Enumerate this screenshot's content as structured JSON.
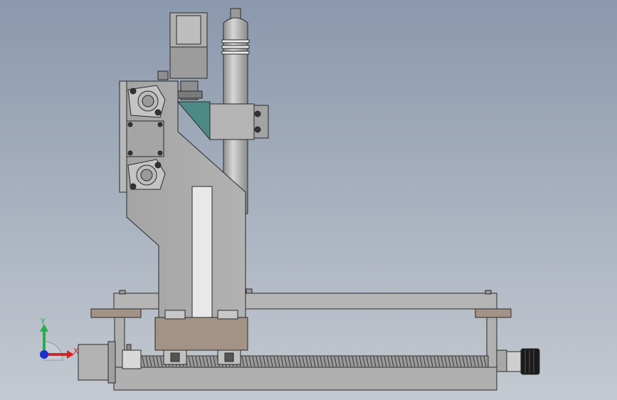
{
  "viewport": {
    "background_top": "#8b98ad",
    "background_bottom": "#c4c9d1"
  },
  "triad": {
    "y_label": "Y",
    "x_label": "X",
    "y_color": "#22b14c",
    "x_color": "#e02020",
    "z_color": "#1a2fcf"
  },
  "colors": {
    "body": "#a8a8a8",
    "body_dark": "#8e8e8e",
    "plate": "#b5b5b5",
    "bronze": "#a39387",
    "teal": "#4d8a85",
    "slot": "#e8e8ea",
    "outline": "#2a2a2a",
    "spindle": "#b9b9b9",
    "screw": "#9c9c9c"
  },
  "icons": [
    "coordinate-triad-icon",
    "stepper-motor-icon",
    "spindle-icon",
    "knob-icon"
  ]
}
